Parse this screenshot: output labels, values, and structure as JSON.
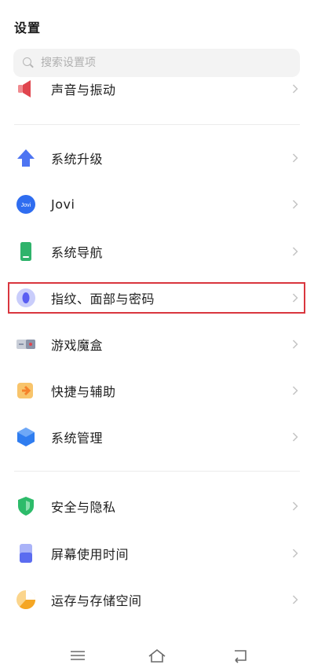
{
  "header": {
    "title": "设置"
  },
  "search": {
    "placeholder": "搜索设置项"
  },
  "items": [
    {
      "label": "声音与振动",
      "icon": "speaker-icon",
      "color": "#e0454e"
    },
    {
      "label": "系统升级",
      "icon": "upgrade-arrow-icon",
      "color": "#4d74f2"
    },
    {
      "label": "Jovi",
      "icon": "jovi-icon",
      "color": "#2f6df0",
      "badge": "Jovi"
    },
    {
      "label": "系统导航",
      "icon": "navigation-phone-icon",
      "color": "#2fb36b"
    },
    {
      "label": "指纹、面部与密码",
      "icon": "fingerprint-icon",
      "color": "#5a5ef2"
    },
    {
      "label": "游戏魔盒",
      "icon": "game-box-icon",
      "color": "#8a93a8"
    },
    {
      "label": "快捷与辅助",
      "icon": "shortcut-icon",
      "color": "#f59a2b"
    },
    {
      "label": "系统管理",
      "icon": "system-management-icon",
      "color": "#2f7df0"
    },
    {
      "label": "安全与隐私",
      "icon": "shield-icon",
      "color": "#2dbb6a"
    },
    {
      "label": "屏幕使用时间",
      "icon": "screen-time-icon",
      "color": "#5b6cf0"
    },
    {
      "label": "运存与存储空间",
      "icon": "storage-icon",
      "color": "#f5a623"
    }
  ],
  "highlight": {
    "color": "#d9363e"
  },
  "navbar": {
    "menu_icon": "menu-icon",
    "home_icon": "home-icon",
    "back_icon": "back-icon"
  }
}
